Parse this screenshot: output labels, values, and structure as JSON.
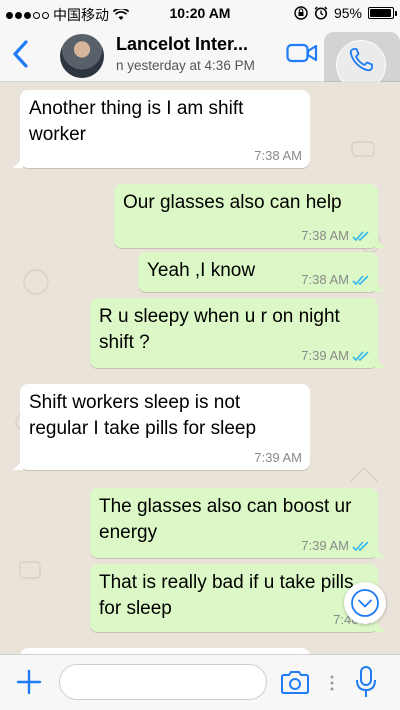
{
  "status_bar": {
    "carrier": "中国移动",
    "time": "10:20 AM",
    "battery": "95%",
    "battery_level": 0.95
  },
  "header": {
    "back_icon": "chevron-left-icon",
    "contact_name": "Lancelot  Inter...",
    "contact_status": "n yesterday at 4:36 PM",
    "video_icon": "video-camera-icon",
    "call_icon": "phone-icon"
  },
  "messages": [
    {
      "dir": "in",
      "text": "Another thing is I am shift worker",
      "time": "7:38 AM"
    },
    {
      "dir": "out",
      "text": "Our glasses also can help",
      "time": "7:38 AM"
    },
    {
      "dir": "out",
      "text": "Yeah ,I know",
      "time": "7:38 AM"
    },
    {
      "dir": "out",
      "text": "R u sleepy when u r on night shift ?",
      "time": "7:39 AM"
    },
    {
      "dir": "in",
      "text": "Shift workers sleep is not regular I take pills for sleep",
      "time": "7:39 AM"
    },
    {
      "dir": "out",
      "text": "The glasses also can boost ur energy",
      "time": "7:39 AM"
    },
    {
      "dir": "out",
      "text": "That is really bad if u take pills for sleep",
      "time": "7:40 A"
    }
  ],
  "input_bar": {
    "placeholder": "",
    "plus_icon": "plus-icon",
    "camera_icon": "camera-icon",
    "mic_icon": "microphone-icon"
  },
  "colors": {
    "accent": "#1f7cf5",
    "incoming_bubble": "#ffffff",
    "outgoing_bubble": "#dcf8c6",
    "read_ticks": "#34b7f1",
    "chat_background": "#e9e3da"
  }
}
